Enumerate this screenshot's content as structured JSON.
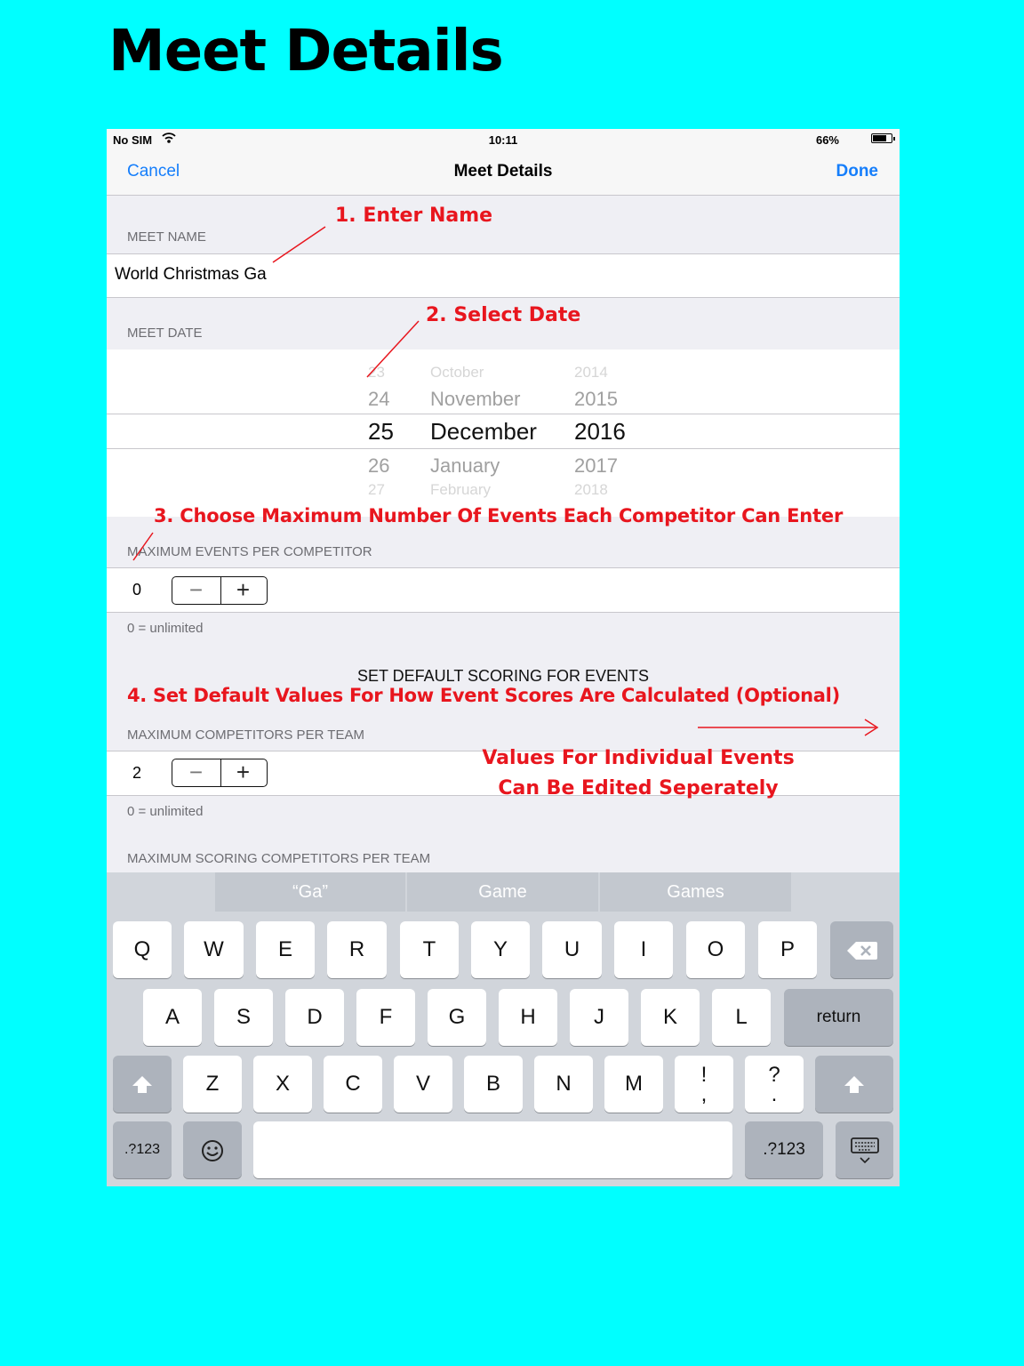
{
  "hero": {
    "title": "Meet Details"
  },
  "status_bar": {
    "carrier": "No SIM",
    "time": "10:11",
    "battery": "66%"
  },
  "nav": {
    "cancel": "Cancel",
    "title": "Meet Details",
    "done": "Done"
  },
  "meet_name": {
    "header": "MEET NAME",
    "value": "World Christmas Ga"
  },
  "meet_date": {
    "header": "MEET DATE",
    "rows": [
      {
        "day": "23",
        "month": "October",
        "year": "2014"
      },
      {
        "day": "24",
        "month": "November",
        "year": "2015"
      },
      {
        "day": "25",
        "month": "December",
        "year": "2016"
      },
      {
        "day": "26",
        "month": "January",
        "year": "2017"
      },
      {
        "day": "27",
        "month": "February",
        "year": "2018"
      }
    ]
  },
  "max_events": {
    "header": "MAXIMUM EVENTS PER COMPETITOR",
    "value": "0",
    "minus": "−",
    "plus": "+",
    "footer": "0 = unlimited"
  },
  "scoring": {
    "title": "SET DEFAULT SCORING FOR EVENTS"
  },
  "max_competitors": {
    "header": "MAXIMUM COMPETITORS PER TEAM",
    "value": "2",
    "minus": "−",
    "plus": "+",
    "footer": "0 = unlimited"
  },
  "max_scoring": {
    "header": "MAXIMUM SCORING COMPETITORS PER TEAM"
  },
  "annotations": {
    "a1": "1. Enter Name",
    "a2": "2. Select Date",
    "a3": "3. Choose Maximum Number Of Events Each Competitor Can Enter",
    "a4": "4. Set Default Values For How Event Scores Are Calculated (Optional)",
    "a5_line1": "Values For Individual Events",
    "a5_line2": "Can Be Edited Seperately"
  },
  "keyboard": {
    "suggestions": [
      "“Ga”",
      "Game",
      "Games"
    ],
    "row1": [
      "Q",
      "W",
      "E",
      "R",
      "T",
      "Y",
      "U",
      "I",
      "O",
      "P"
    ],
    "row2": [
      "A",
      "S",
      "D",
      "F",
      "G",
      "H",
      "J",
      "K",
      "L"
    ],
    "row3": [
      "Z",
      "X",
      "C",
      "V",
      "B",
      "N",
      "M"
    ],
    "excl_top": "!",
    "excl_bottom": ",",
    "quest_top": "?",
    "quest_bottom": ".",
    "return": "return",
    "numbers": ".?123"
  },
  "colors": {
    "background": "#00FFFF",
    "annotation": "#E8161E",
    "ios_blue": "#157EFB"
  },
  "icons": [
    "wifi-icon",
    "battery-icon",
    "backspace-icon",
    "shift-icon",
    "emoji-icon",
    "keyboard-dismiss-icon"
  ]
}
